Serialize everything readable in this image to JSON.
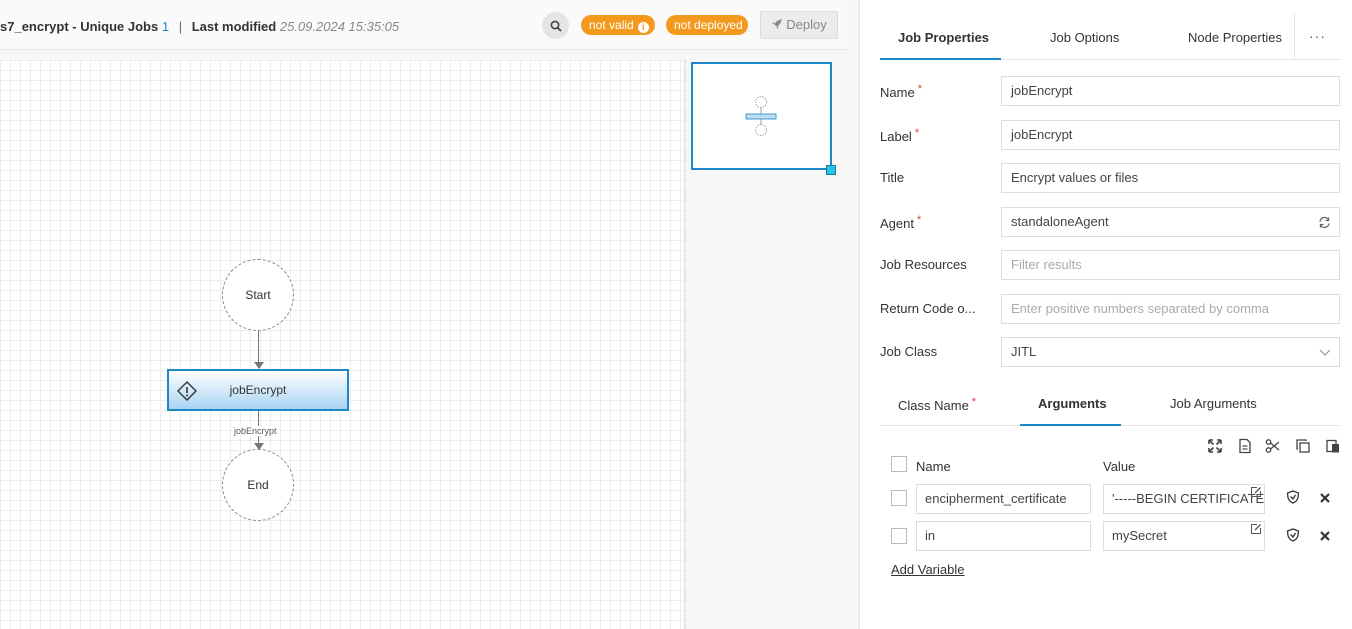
{
  "header": {
    "workflow_name": "s7_encrypt - Unique Jobs",
    "unique_jobs_count": "1",
    "separator": "|",
    "last_modified_label": "Last modified",
    "last_modified_value": "25.09.2024 15:35:05",
    "badge_not_valid": "not valid",
    "badge_info_glyph": "i",
    "badge_not_deployed": "not deployed",
    "deploy_label": "Deploy"
  },
  "graph": {
    "start_label": "Start",
    "job_label": "jobEncrypt",
    "edge_label": "jobEncrypt",
    "end_label": "End"
  },
  "tabs": {
    "job_properties": "Job Properties",
    "job_options": "Job Options",
    "node_properties": "Node Properties",
    "more": "···"
  },
  "form": {
    "name_label": "Name",
    "name_value": "jobEncrypt",
    "label_label": "Label",
    "label_value": "jobEncrypt",
    "title_label": "Title",
    "title_value": "Encrypt values or files",
    "agent_label": "Agent",
    "agent_value": "standaloneAgent",
    "job_resources_label": "Job Resources",
    "job_resources_placeholder": "Filter results",
    "return_code_label": "Return Code o...",
    "return_code_placeholder": "Enter positive numbers separated by comma",
    "job_class_label": "Job Class",
    "job_class_value": "JITL",
    "required_mark": "*"
  },
  "subtabs": {
    "class_name": "Class Name",
    "arguments": "Arguments",
    "job_arguments": "Job Arguments"
  },
  "arguments": {
    "name_header": "Name",
    "value_header": "Value",
    "rows": [
      {
        "name": "encipherment_certificate",
        "value": "'-----BEGIN CERTIFICATE-"
      },
      {
        "name": "in",
        "value": "mySecret"
      }
    ],
    "add_variable": "Add Variable"
  },
  "colors": {
    "accent": "#1e88c7",
    "badge": "#f39a1e",
    "required": "#e53935"
  }
}
